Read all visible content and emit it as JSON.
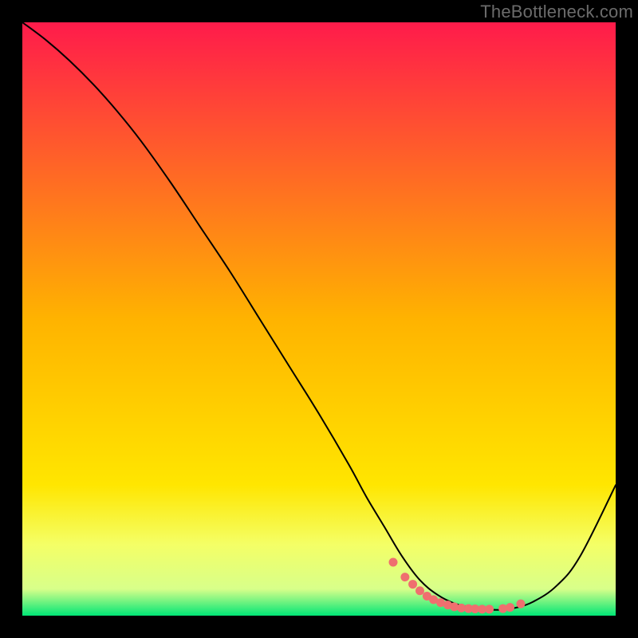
{
  "watermark": "TheBottleneck.com",
  "chart_data": {
    "type": "line",
    "title": "",
    "xlabel": "",
    "ylabel": "",
    "xlim": [
      0,
      100
    ],
    "ylim": [
      0,
      100
    ],
    "grid": false,
    "legend": false,
    "gradient_stops": [
      {
        "offset": 0,
        "color": "#ff1b4b"
      },
      {
        "offset": 0.5,
        "color": "#ffb300"
      },
      {
        "offset": 0.78,
        "color": "#ffe600"
      },
      {
        "offset": 0.88,
        "color": "#f4ff66"
      },
      {
        "offset": 0.955,
        "color": "#d8ff8a"
      },
      {
        "offset": 1.0,
        "color": "#00e676"
      }
    ],
    "series": [
      {
        "name": "bottleneck-curve",
        "stroke": "#000000",
        "stroke_width": 2,
        "x": [
          0,
          4,
          8,
          12,
          16,
          20,
          25,
          30,
          35,
          40,
          45,
          50,
          55,
          58,
          61,
          64,
          67,
          70,
          73,
          76,
          79,
          81,
          83,
          86,
          90,
          94,
          100
        ],
        "y": [
          100,
          97,
          93.5,
          89.5,
          85,
          80,
          73,
          65.5,
          58,
          50,
          42,
          34,
          25.5,
          20,
          15,
          10,
          6,
          3.5,
          2,
          1.3,
          1,
          1,
          1.3,
          2.3,
          5,
          10,
          22
        ]
      }
    ],
    "markers": {
      "name": "valley-dots",
      "color": "#ef6f6f",
      "radius": 5.5,
      "x": [
        62.5,
        64.5,
        65.8,
        67.0,
        68.2,
        69.3,
        70.5,
        71.7,
        72.8,
        74.0,
        75.2,
        76.3,
        77.5,
        78.7,
        81.0,
        82.2,
        84.0
      ],
      "y": [
        9.0,
        6.5,
        5.3,
        4.2,
        3.3,
        2.7,
        2.2,
        1.8,
        1.5,
        1.3,
        1.2,
        1.15,
        1.1,
        1.1,
        1.2,
        1.4,
        2.0
      ]
    }
  }
}
